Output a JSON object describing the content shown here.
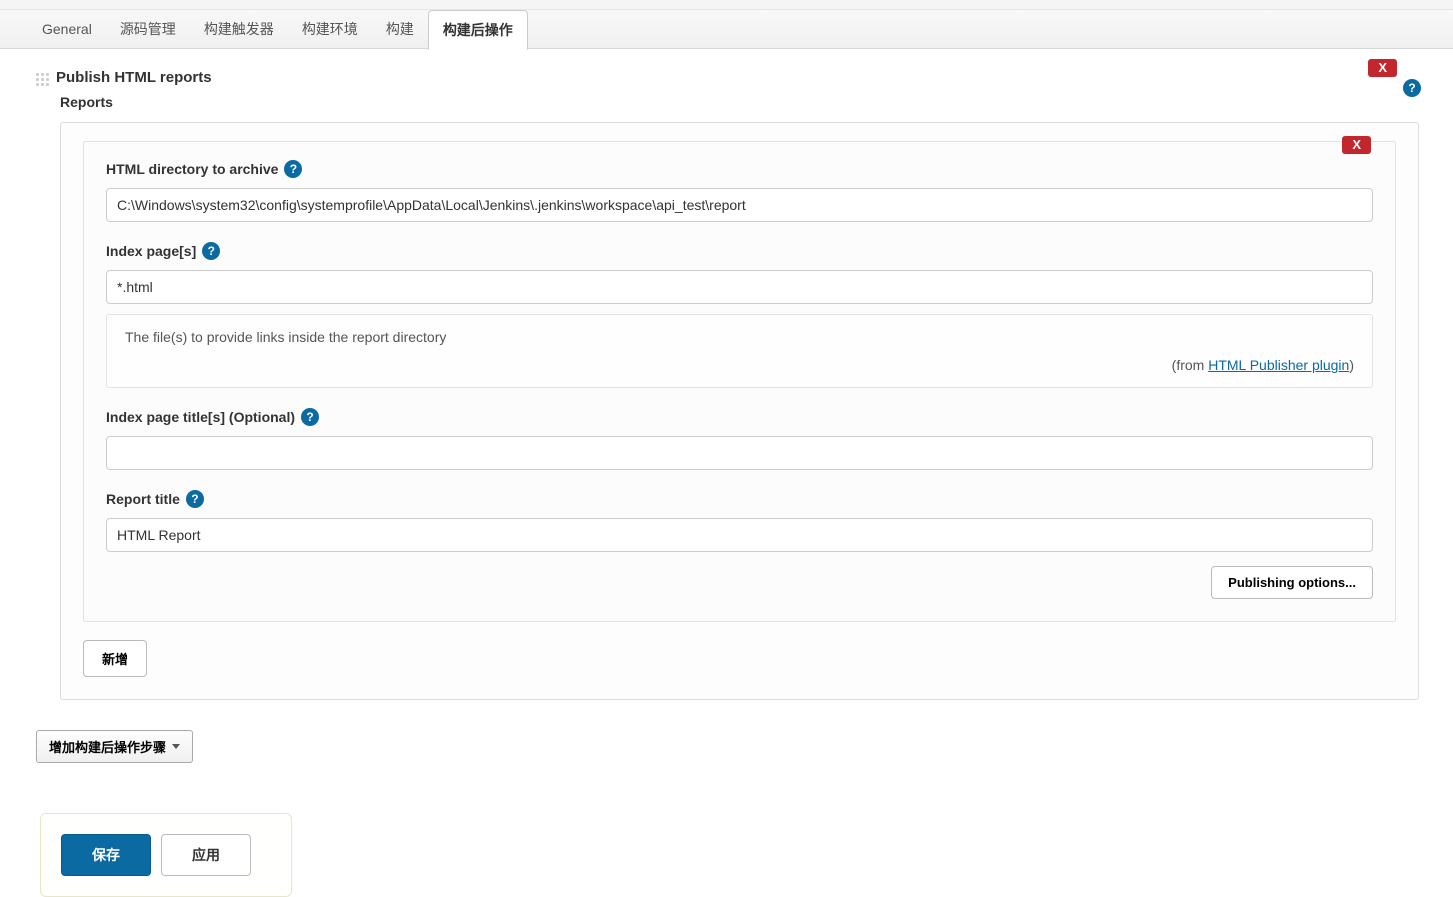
{
  "tabs": [
    {
      "label": "General"
    },
    {
      "label": "源码管理"
    },
    {
      "label": "构建触发器"
    },
    {
      "label": "构建环境"
    },
    {
      "label": "构建"
    },
    {
      "label": "构建后操作"
    }
  ],
  "section": {
    "title": "Publish HTML reports",
    "reports_label": "Reports",
    "delete_outer": "X",
    "delete_inner": "X",
    "fields": {
      "html_dir": {
        "label": "HTML directory to archive",
        "value": "C:\\Windows\\system32\\config\\systemprofile\\AppData\\Local\\Jenkins\\.jenkins\\workspace\\api_test\\report"
      },
      "index_pages": {
        "label": "Index page[s]",
        "value": "*.html",
        "help_text": "The file(s) to provide links inside the report directory",
        "from_prefix": "(from ",
        "from_link": "HTML Publisher plugin",
        "from_suffix": ")"
      },
      "index_titles": {
        "label": "Index page title[s] (Optional)",
        "value": ""
      },
      "report_title": {
        "label": "Report title",
        "value": "HTML Report"
      }
    },
    "publishing_options_label": "Publishing options...",
    "add_button_label": "新增"
  },
  "add_post_build_label": "增加构建后操作步骤",
  "actions": {
    "save": "保存",
    "apply": "应用"
  },
  "help_glyph": "?"
}
